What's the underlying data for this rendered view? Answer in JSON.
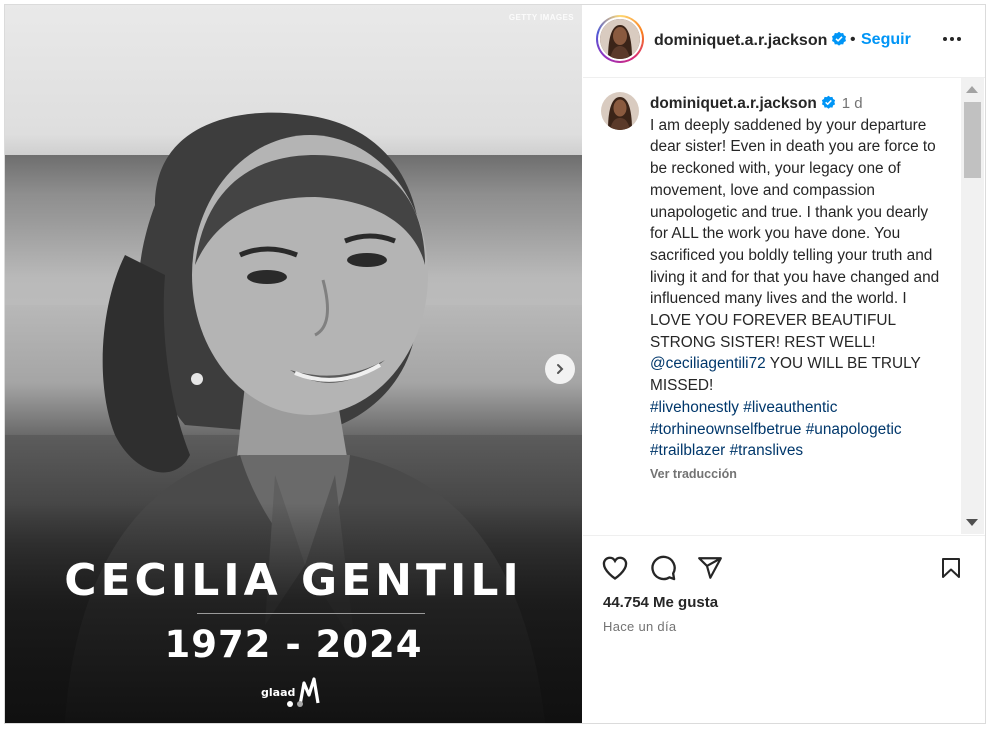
{
  "media": {
    "credit": "GETTY IMAGES",
    "name": "CECILIA GENTILI",
    "years": "1972 - 2024",
    "logo_text": "glaad",
    "carousel_total": 2,
    "carousel_active": 1
  },
  "header": {
    "username": "dominiquet.a.r.jackson",
    "separator": "•",
    "follow_label": "Seguir"
  },
  "comment": {
    "username": "dominiquet.a.r.jackson",
    "time": "1 d",
    "text_part1": "I am deeply saddened by your departure dear sister! Even in death you are force to be reckoned with, your legacy one of movement, love and compassion unapologetic and true. I thank you dearly for ALL the work you have done. You sacrificed you boldly telling your truth and living it and for that you have changed and influenced many lives and the world. I LOVE YOU FOREVER BEAUTIFUL STRONG SISTER! REST WELL!",
    "mention": "@ceciliagentili72",
    "text_part2": " YOU WILL BE TRULY MISSED!",
    "tags": [
      "#livehonestly",
      "#liveauthentic",
      "#torhineownselfbetrue",
      "#unapologetic",
      "#trailblazer",
      "#translives"
    ],
    "translate_label": "Ver traducción"
  },
  "footer": {
    "likes": "44.754 Me gusta",
    "posted": "Hace un día"
  },
  "icons": {
    "like": "heart-icon",
    "comment": "comment-bubble-icon",
    "share": "paper-plane-icon",
    "save": "bookmark-icon",
    "more": "more-dots-icon",
    "next": "chevron-right-icon",
    "verified": "verified-badge-icon"
  },
  "colors": {
    "link": "#00376b",
    "follow": "#0095f6",
    "verified": "#0095f6",
    "muted": "#737373"
  }
}
